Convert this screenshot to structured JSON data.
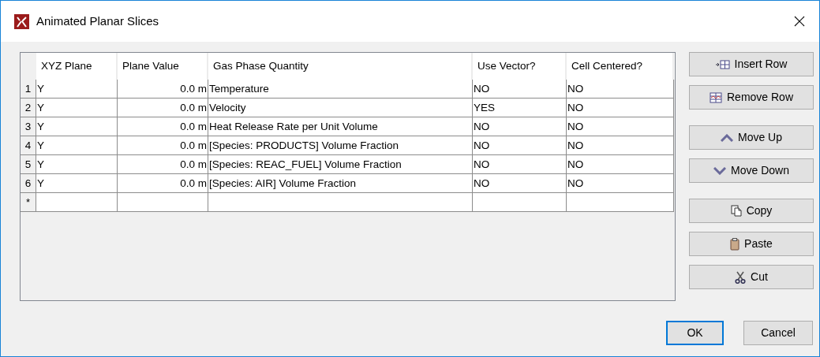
{
  "window": {
    "title": "Animated Planar Slices"
  },
  "table": {
    "columns": [
      "XYZ Plane",
      "Plane Value",
      "Gas Phase Quantity",
      "Use Vector?",
      "Cell Centered?"
    ],
    "rows": [
      {
        "number": "1",
        "cells": [
          "Y",
          "0.0 m",
          "Temperature",
          "NO",
          "NO"
        ]
      },
      {
        "number": "2",
        "cells": [
          "Y",
          "0.0 m",
          "Velocity",
          "YES",
          "NO"
        ]
      },
      {
        "number": "3",
        "cells": [
          "Y",
          "0.0 m",
          "Heat Release Rate per Unit Volume",
          "NO",
          "NO"
        ]
      },
      {
        "number": "4",
        "cells": [
          "Y",
          "0.0 m",
          "[Species: PRODUCTS] Volume Fraction",
          "NO",
          "NO"
        ]
      },
      {
        "number": "5",
        "cells": [
          "Y",
          "0.0 m",
          "[Species: REAC_FUEL] Volume Fraction",
          "NO",
          "NO"
        ]
      },
      {
        "number": "6",
        "cells": [
          "Y",
          "0.0 m",
          "[Species: AIR] Volume Fraction",
          "NO",
          "NO"
        ]
      }
    ],
    "new_row_marker": "*"
  },
  "side_buttons": [
    {
      "label": "Insert Row",
      "kind": "insert"
    },
    {
      "label": "Remove Row",
      "kind": "remove"
    },
    {
      "label": "Move Up",
      "kind": "up"
    },
    {
      "label": "Move Down",
      "kind": "down"
    },
    {
      "label": "Copy",
      "kind": "copy"
    },
    {
      "label": "Paste",
      "kind": "paste"
    },
    {
      "label": "Cut",
      "kind": "cut"
    }
  ],
  "dialog_buttons": [
    {
      "label": "OK",
      "focused": true
    },
    {
      "label": "Cancel",
      "focused": false
    }
  ]
}
